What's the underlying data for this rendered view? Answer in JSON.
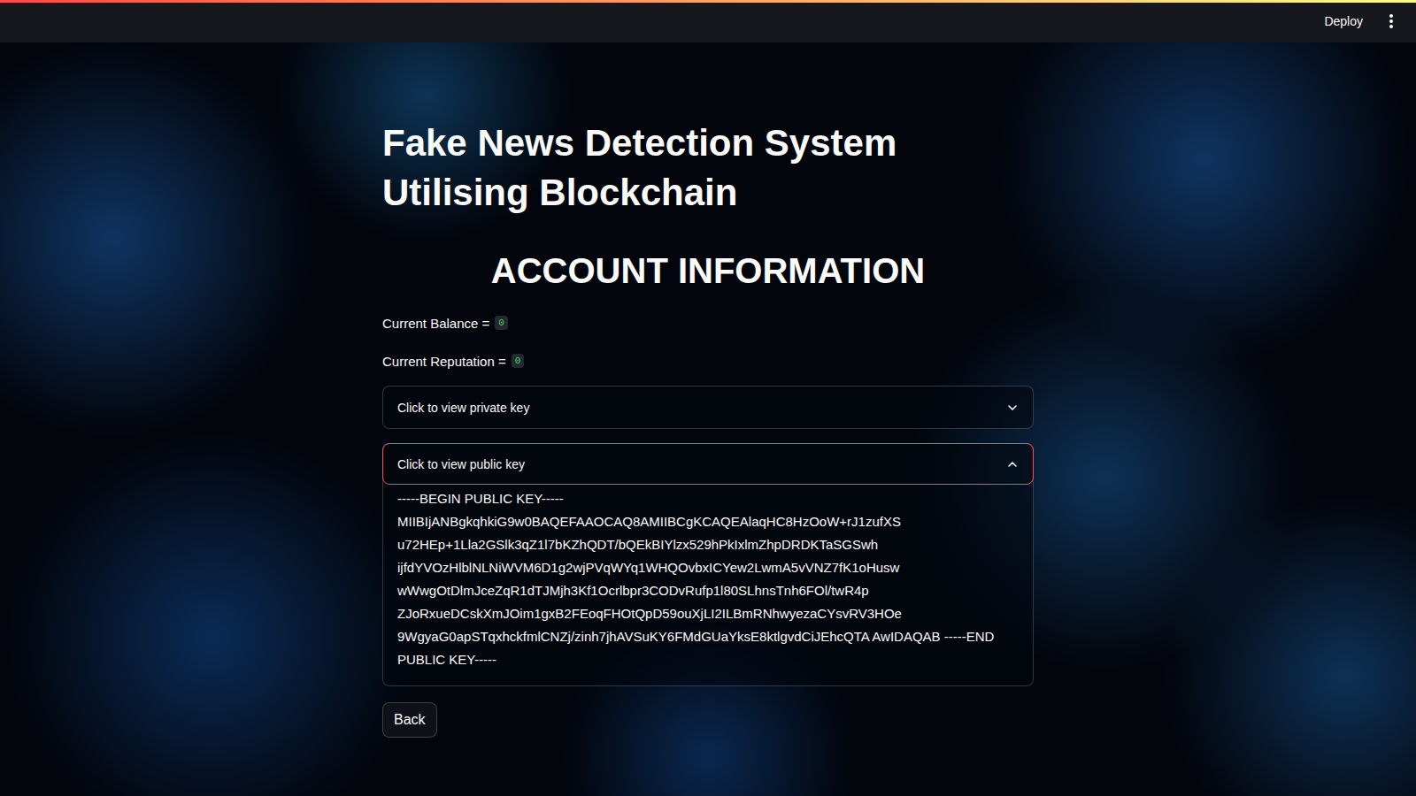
{
  "header": {
    "deploy": "Deploy"
  },
  "title": "Fake News Detection System Utilising Blockchain",
  "heading": "ACCOUNT INFORMATION",
  "stats": [
    {
      "label": "Current Balance =",
      "value": "0"
    },
    {
      "label": "Current Reputation =",
      "value": "0"
    }
  ],
  "expanders": [
    {
      "label": "Click to view private key",
      "expanded": false,
      "focused": false,
      "content": ""
    },
    {
      "label": "Click to view public key",
      "expanded": true,
      "focused": true,
      "content": "-----BEGIN PUBLIC KEY----- MIIBIjANBgkqhkiG9w0BAQEFAAOCAQ8AMIIBCgKCAQEAlaqHC8HzOoW+rJ1zufXS u72HEp+1Lla2GSlk3qZ1l7bKZhQDT/bQEkBIYlzx529hPkIxlmZhpDRDKTaSGSwh ijfdYVOzHlblNLNiWVM6D1g2wjPVqWYq1WHQOvbxICYew2LwmA5vVNZ7fK1oHusw wWwgOtDlmJceZqR1dTJMjh3Kf1Ocrlbpr3CODvRufp1l80SLhnsTnh6FOl/twR4p ZJoRxueDCskXmJOim1gxB2FEoqFHOtQpD59ouXjLI2ILBmRNhwyezaCYsvRV3HOe 9WgyaG0apSTqxhckfmlCNZj/zinh7jhAVSuKY6FMdGUaYksE8ktlgvdCiJEhcQTA AwIDAQAB -----END PUBLIC KEY-----"
    }
  ],
  "buttons": [
    "Back"
  ]
}
